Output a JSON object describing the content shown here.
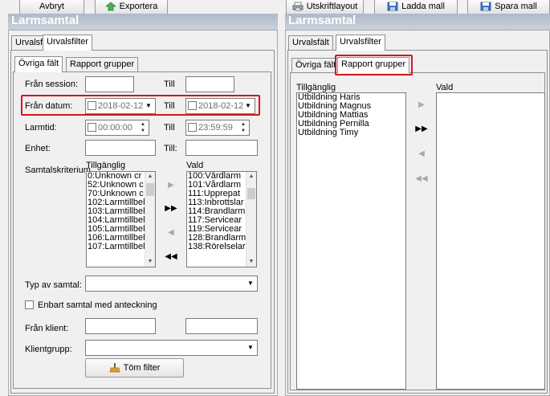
{
  "toolbar": {
    "cancel_label": "Avbryt",
    "export_label": "Exportera",
    "print_layout_label": "Utskriftlayout",
    "load_template_label": "Ladda mall",
    "save_template_label": "Spara mall"
  },
  "left": {
    "header_title": "Larmsamtal",
    "tabs": [
      "Urvalsfält",
      "Urvalsfilter"
    ],
    "subtabs": [
      "Övriga fält",
      "Rapport grupper"
    ],
    "from_session_label": "Från session:",
    "to_label": "Till",
    "to_label_colon": "Till:",
    "from_date_label": "Från datum:",
    "from_date_value": "2018-02-12",
    "to_date_value": "2018-02-12",
    "alarm_time_label": "Larmtid:",
    "from_time_value": "00:00:00",
    "to_time_value": "23:59:59",
    "unit_label": "Enhet:",
    "call_criteria_label": "Samtalskriterium",
    "available_label": "Tillgänglig",
    "selected_label": "Vald",
    "available_items": [
      "0:Unknown cr",
      "52:Unknown c",
      "70:Unknown c",
      "102:Larmtillbel",
      "103:Larmtillbel",
      "104:Larmtillbel",
      "105:Larmtillbel",
      "106:Larmtillbel",
      "107:Larmtillbel"
    ],
    "selected_items": [
      "100:Vårdlarm",
      "101:Vårdlarm",
      "111:Upprepat",
      "113:Inbrottslar",
      "114:Brandlarm",
      "117:Servicear",
      "119:Servicear",
      "128:Brandlarm",
      "138:Rörelselar"
    ],
    "call_type_label": "Typ av samtal:",
    "only_with_note_label": "Enbart samtal med anteckning",
    "from_client_label": "Från klient:",
    "client_group_label": "Klientgrupp:",
    "clear_filter_label": "Töm filter"
  },
  "right": {
    "header_title": "Larmsamtal",
    "tabs": [
      "Urvalsfält",
      "Urvalsfilter"
    ],
    "subtabs": [
      "Övriga fält",
      "Rapport grupper"
    ],
    "available_label": "Tillgänglig",
    "selected_label": "Vald",
    "available_items": [
      "Utbildning Haris",
      "Utbildning Magnus",
      "Utbildning Mattias",
      "Utbildning Pernilla",
      "Utbildning Timy"
    ]
  },
  "colors": {
    "highlight": "#d6161b",
    "header": "#b4bfcd"
  },
  "icons": {
    "export": "export-icon",
    "print_layout": "printer-icon",
    "load_template": "save-disk-icon",
    "save_template": "save-disk-icon",
    "clear_filter": "broom-icon"
  }
}
